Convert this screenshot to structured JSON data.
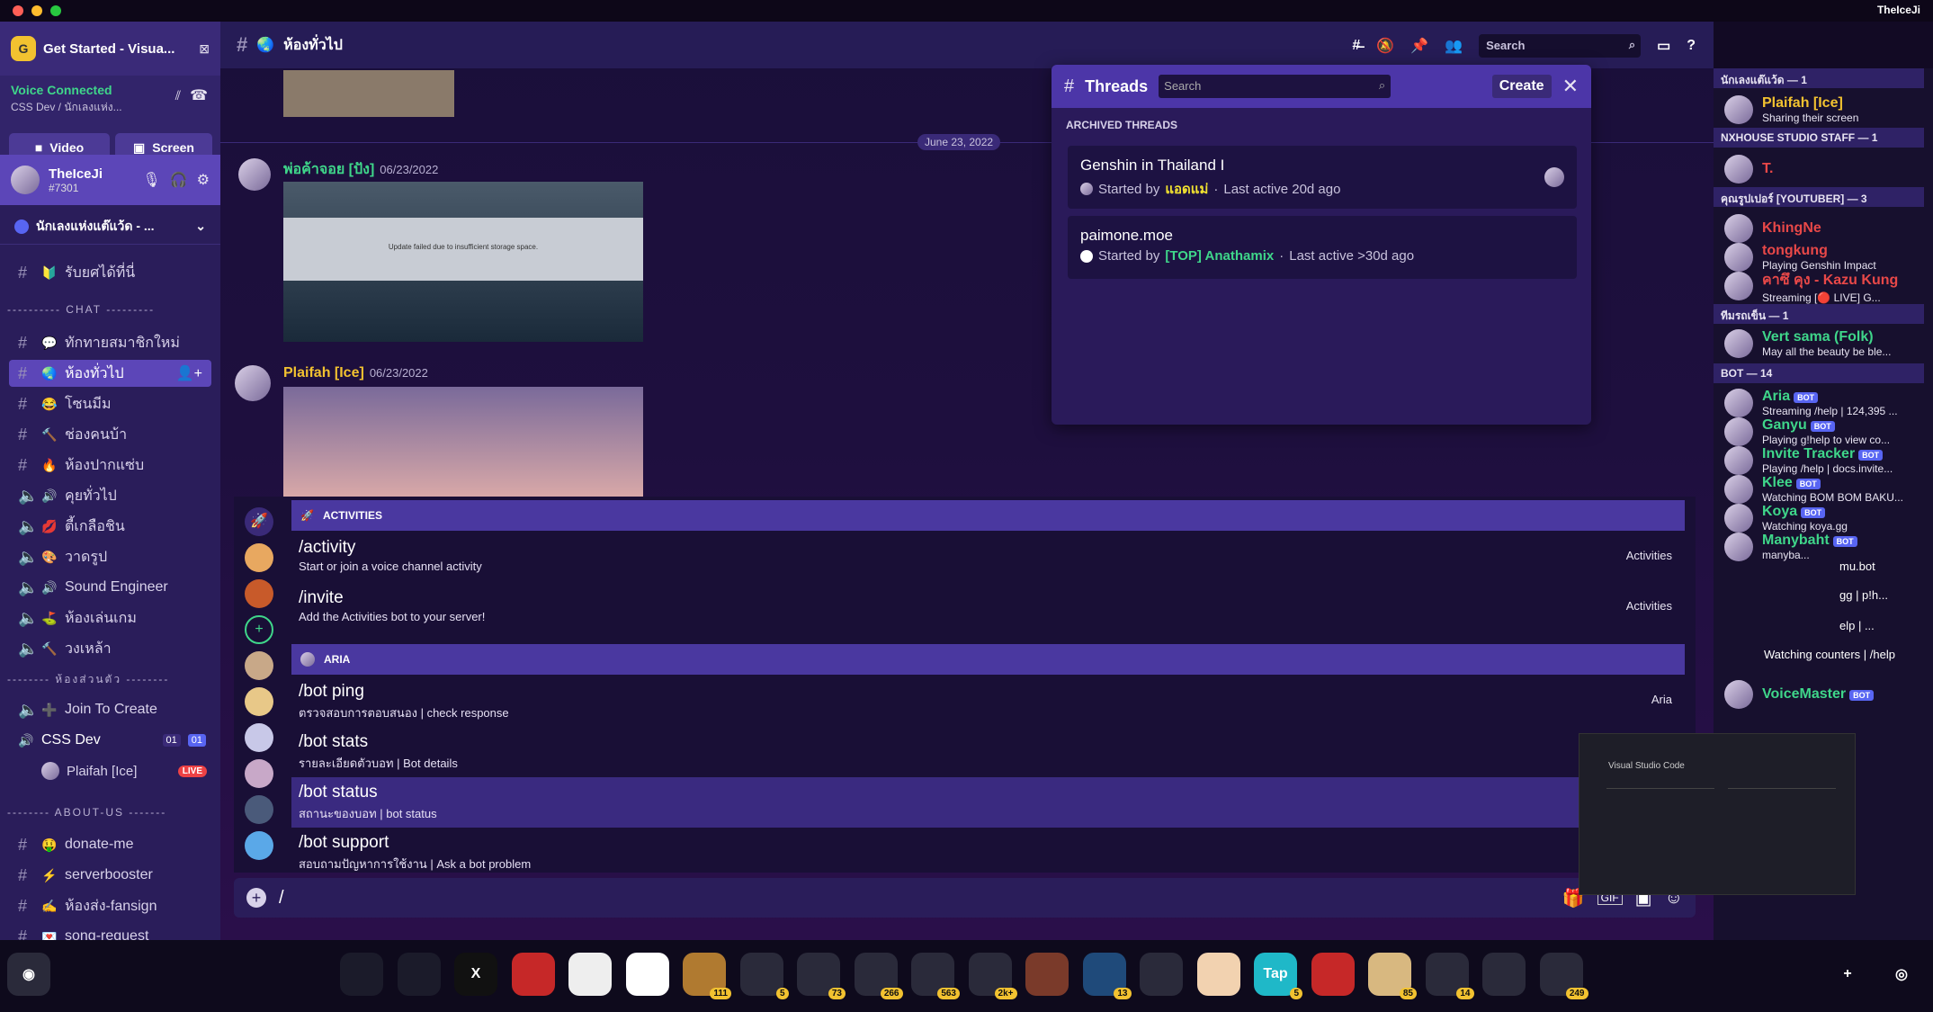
{
  "mac": {
    "user": "TheIceJi"
  },
  "server": {
    "title": "Get Started - Visua..."
  },
  "voice": {
    "status": "Voice Connected",
    "channel": "CSS Dev / นักเลงแห่ง...",
    "video_label": "Video",
    "screen_label": "Screen"
  },
  "user": {
    "name": "TheIceJi",
    "tag": "#7301"
  },
  "guild": {
    "name": "นักเลงแห่งแต๊แว้ด - ..."
  },
  "channels": [
    {
      "kind": "text",
      "emoji": "🔰",
      "name": "รับยศได้ที่นี่"
    },
    {
      "kind": "text",
      "emoji": "💬",
      "name": "ทักทายสมาชิกใหม่"
    },
    {
      "kind": "text",
      "emoji": "🌏",
      "name": "ห้องทั่วไป"
    },
    {
      "kind": "text",
      "emoji": "😂",
      "name": "โซนมีม"
    },
    {
      "kind": "text",
      "emoji": "🔨",
      "name": "ช่องคนบ้า"
    },
    {
      "kind": "text",
      "emoji": "🔥",
      "name": "ห้องปากแซ่บ"
    },
    {
      "kind": "voice",
      "emoji": "🔊",
      "name": "คุยทั่วไป"
    },
    {
      "kind": "voice",
      "emoji": "💋",
      "name": "ตี้เกลือชิน"
    },
    {
      "kind": "voice",
      "emoji": "🎨",
      "name": "วาดรูป"
    },
    {
      "kind": "voice",
      "emoji": "🔊",
      "name": "Sound Engineer"
    },
    {
      "kind": "voice",
      "emoji": "⛳",
      "name": "ห้องเล่นเกม"
    },
    {
      "kind": "voice",
      "emoji": "🔨",
      "name": "วงเหล้า"
    },
    {
      "kind": "voice",
      "emoji": "➕",
      "name": "Join To Create"
    },
    {
      "kind": "text",
      "emoji": "🤑",
      "name": "donate-me"
    },
    {
      "kind": "text",
      "emoji": "⚡",
      "name": "serverbooster"
    },
    {
      "kind": "text",
      "emoji": "✍",
      "name": "ห้องส่ง-fansign"
    },
    {
      "kind": "text",
      "emoji": "💌",
      "name": "song-request"
    }
  ],
  "categories": {
    "chat": "---------- CHAT ---------",
    "private": "-------- ห้องส่วนตัว --------",
    "about": "-------- ABOUT-US -------"
  },
  "voice_room": {
    "name": "CSS Dev",
    "count_a": "01",
    "count_b": "01",
    "member": "Plaifah [Ice]",
    "live": "LIVE"
  },
  "topbar": {
    "channel": "ห้องทั่วไป",
    "search": "Search"
  },
  "messages": {
    "date_divider": "June 23, 2022",
    "m1": {
      "author": "พ่อค้าจอย [ปัง]",
      "date": "06/23/2022",
      "image_text": "Update failed due to insufficient storage space."
    },
    "m2": {
      "author": "Plaifah [Ice]",
      "date": "06/23/2022"
    }
  },
  "threads": {
    "title": "Threads",
    "search": "Search",
    "create": "Create",
    "archived": "ARCHIVED THREADS",
    "items": [
      {
        "name": "Genshin in Thailand I",
        "started_by": "Started by",
        "author": "แอดแม่",
        "activity": "Last active 20d ago"
      },
      {
        "name": "paimone.moe",
        "started_by": "Started by",
        "author": "[TOP] Anathamix",
        "activity": "Last active >30d ago"
      }
    ]
  },
  "autocomplete": {
    "sec1": "ACTIVITIES",
    "sec2": "ARIA",
    "cmds": [
      {
        "name": "/activity",
        "desc": "Start or join a voice channel activity",
        "src": "Activities"
      },
      {
        "name": "/invite",
        "desc": "Add the Activities bot to your server!",
        "src": "Activities"
      },
      {
        "name": "/bot ping",
        "desc": "ตรวจสอบการตอบสนอง | check response",
        "src": "Aria"
      },
      {
        "name": "/bot stats",
        "desc": "รายละเอียดตัวบอท | Bot details",
        "src": ""
      },
      {
        "name": "/bot status",
        "desc": "สถานะของบอท | bot status",
        "src": ""
      },
      {
        "name": "/bot support",
        "desc": "สอบถามปัญหาการใช้งาน | Ask a bot problem",
        "src": ""
      }
    ]
  },
  "input": {
    "value": "/"
  },
  "members": {
    "cats": [
      "นักเลงแต๊แว้ด — 1",
      "NXHOUSE STUDIO STAFF — 1",
      "คุณรูปเปอร์ [YOUTUBER] — 3",
      "ทีมรถเข็น — 1",
      "BOT — 14"
    ],
    "list": [
      {
        "name": "Plaifah [Ice]",
        "status": "Sharing their screen",
        "color": "#f2c230",
        "bot": false
      },
      {
        "name": "T.",
        "status": "",
        "color": "#e84848",
        "bot": false
      },
      {
        "name": "KhingNe",
        "status": "",
        "color": "#e84848",
        "bot": false
      },
      {
        "name": "tongkung",
        "status": "Playing Genshin Impact",
        "color": "#e84848",
        "bot": false
      },
      {
        "name": "คาซึ คุง - Kazu Kung",
        "status": "Streaming [🔴 LIVE] G...",
        "color": "#e84848",
        "bot": false
      },
      {
        "name": "Vert sama (Folk)",
        "status": "May all the beauty be ble...",
        "color": "#3fd68a",
        "bot": false
      },
      {
        "name": "Aria",
        "status": "Streaming /help | 124,395 ...",
        "color": "#3fd68a",
        "bot": true
      },
      {
        "name": "Ganyu",
        "status": "Playing g!help to view co...",
        "color": "#3fd68a",
        "bot": true
      },
      {
        "name": "Invite Tracker",
        "status": "Playing /help | docs.invite...",
        "color": "#3fd68a",
        "bot": true
      },
      {
        "name": "Klee",
        "status": "Watching BOM BOM BAKU...",
        "color": "#3fd68a",
        "bot": true
      },
      {
        "name": "Koya",
        "status": "Watching koya.gg",
        "color": "#3fd68a",
        "bot": true
      },
      {
        "name": "Manybaht",
        "status": "manyba...",
        "color": "#3fd68a",
        "bot": true
      },
      {
        "name": "VoiceMaster",
        "status": "",
        "color": "#3fd68a",
        "bot": true
      }
    ],
    "partial": [
      "mu.bot",
      "gg | p!h...",
      "elp | ...",
      "Watching counters | /help"
    ],
    "bot_label": "BOT"
  },
  "preview": {
    "title": "Visual Studio Code"
  },
  "dock": [
    {
      "label": "",
      "badge": "",
      "color": "#1b1b2a"
    },
    {
      "label": "",
      "badge": "",
      "color": "#1b1b2a"
    },
    {
      "label": "X",
      "badge": "",
      "color": "#111"
    },
    {
      "label": "",
      "badge": "",
      "color": "#c62828"
    },
    {
      "label": "",
      "badge": "",
      "color": "#eee"
    },
    {
      "label": "",
      "badge": "",
      "color": "#fff"
    },
    {
      "label": "",
      "badge": "111",
      "color": "#b07a30"
    },
    {
      "label": "",
      "badge": "5",
      "color": "#2a2a3a"
    },
    {
      "label": "",
      "badge": "73",
      "color": "#2a2a3a"
    },
    {
      "label": "",
      "badge": "266",
      "color": "#2a2a3a"
    },
    {
      "label": "",
      "badge": "563",
      "color": "#2a2a3a"
    },
    {
      "label": "",
      "badge": "2k+",
      "color": "#2a2a3a"
    },
    {
      "label": "",
      "badge": "",
      "color": "#7a3a2a"
    },
    {
      "label": "",
      "badge": "13",
      "color": "#1f4a7a"
    },
    {
      "label": "",
      "badge": "",
      "color": "#2a2a3a"
    },
    {
      "label": "",
      "badge": "",
      "color": "#f2d2b0"
    },
    {
      "label": "Tap",
      "badge": "5",
      "color": "#1fb8c8"
    },
    {
      "label": "",
      "badge": "",
      "color": "#c62828"
    },
    {
      "label": "",
      "badge": "85",
      "color": "#d8b880"
    },
    {
      "label": "",
      "badge": "14",
      "color": "#2a2a3a"
    },
    {
      "label": "",
      "badge": "",
      "color": "#2a2a3a"
    },
    {
      "label": "",
      "badge": "249",
      "color": "#2a2a3a"
    }
  ]
}
